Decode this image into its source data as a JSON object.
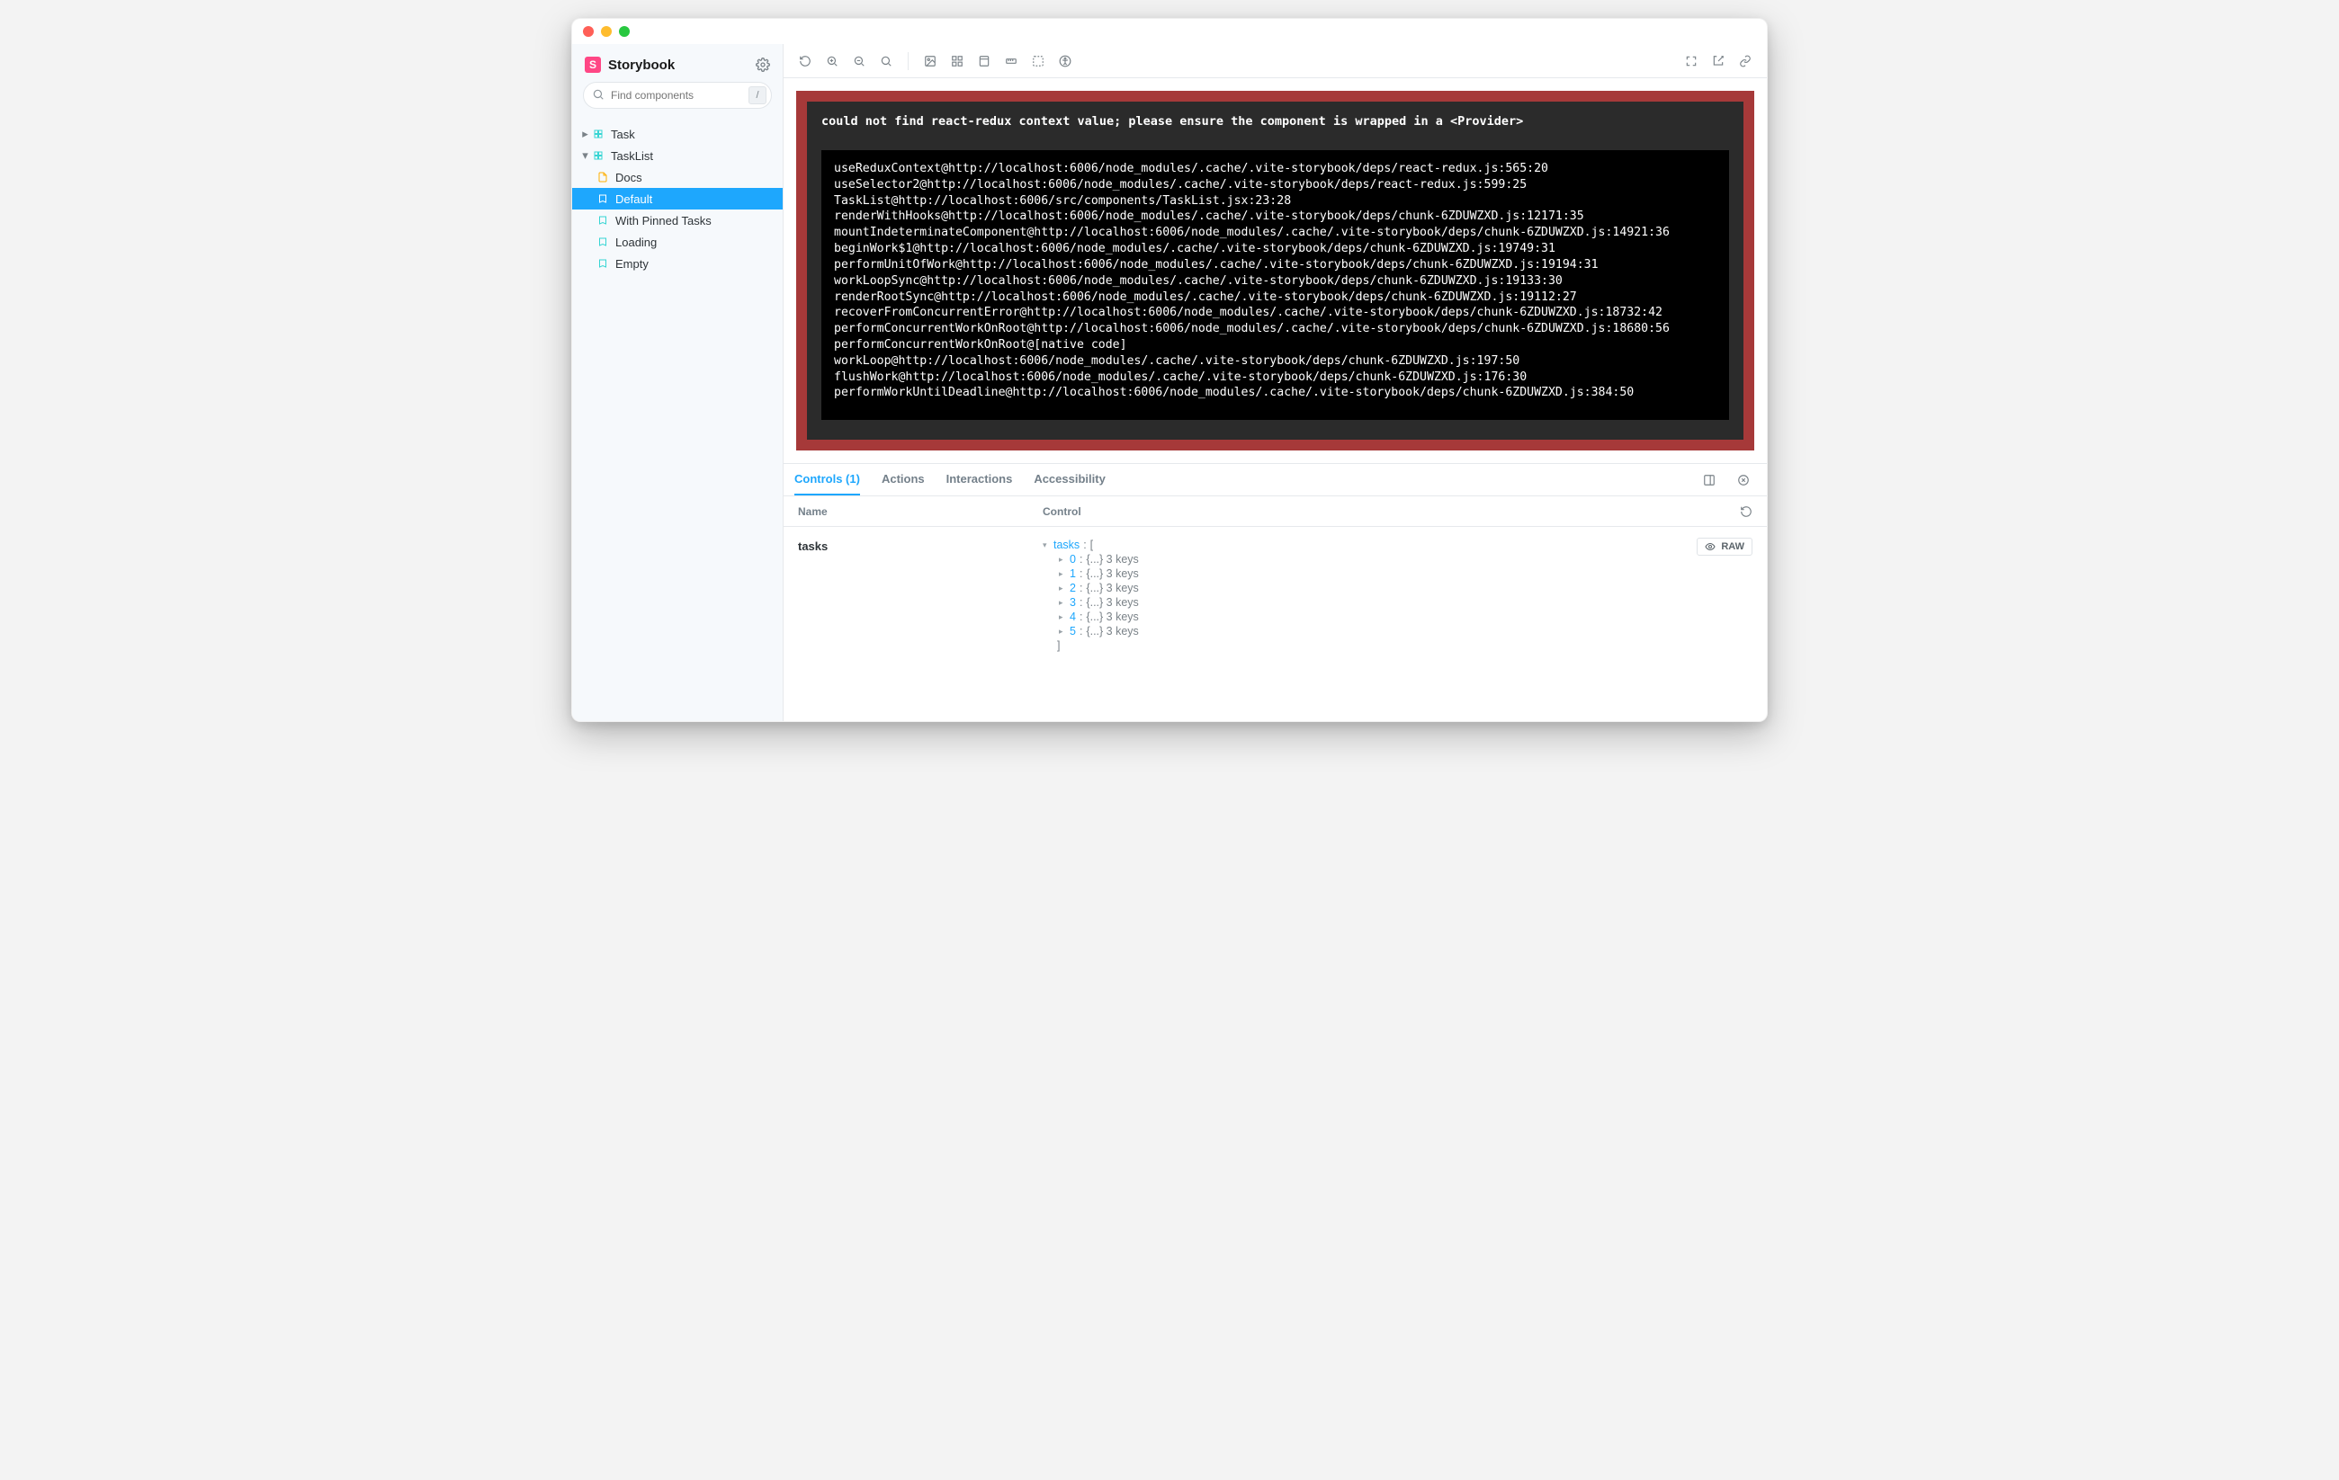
{
  "app": {
    "name": "Storybook"
  },
  "search": {
    "placeholder": "Find components",
    "shortcut": "/"
  },
  "tree": {
    "items": [
      {
        "label": "Task",
        "kind": "component",
        "level": 0,
        "expanded": false
      },
      {
        "label": "TaskList",
        "kind": "component",
        "level": 0,
        "expanded": true
      },
      {
        "label": "Docs",
        "kind": "docs",
        "level": 1
      },
      {
        "label": "Default",
        "kind": "story",
        "level": 1,
        "selected": true
      },
      {
        "label": "With Pinned Tasks",
        "kind": "story",
        "level": 1
      },
      {
        "label": "Loading",
        "kind": "story",
        "level": 1
      },
      {
        "label": "Empty",
        "kind": "story",
        "level": 1
      }
    ]
  },
  "error": {
    "message": "could not find react-redux context value; please ensure the component is wrapped in a <Provider>",
    "stack": "useReduxContext@http://localhost:6006/node_modules/.cache/.vite-storybook/deps/react-redux.js:565:20\nuseSelector2@http://localhost:6006/node_modules/.cache/.vite-storybook/deps/react-redux.js:599:25\nTaskList@http://localhost:6006/src/components/TaskList.jsx:23:28\nrenderWithHooks@http://localhost:6006/node_modules/.cache/.vite-storybook/deps/chunk-6ZDUWZXD.js:12171:35\nmountIndeterminateComponent@http://localhost:6006/node_modules/.cache/.vite-storybook/deps/chunk-6ZDUWZXD.js:14921:36\nbeginWork$1@http://localhost:6006/node_modules/.cache/.vite-storybook/deps/chunk-6ZDUWZXD.js:19749:31\nperformUnitOfWork@http://localhost:6006/node_modules/.cache/.vite-storybook/deps/chunk-6ZDUWZXD.js:19194:31\nworkLoopSync@http://localhost:6006/node_modules/.cache/.vite-storybook/deps/chunk-6ZDUWZXD.js:19133:30\nrenderRootSync@http://localhost:6006/node_modules/.cache/.vite-storybook/deps/chunk-6ZDUWZXD.js:19112:27\nrecoverFromConcurrentError@http://localhost:6006/node_modules/.cache/.vite-storybook/deps/chunk-6ZDUWZXD.js:18732:42\nperformConcurrentWorkOnRoot@http://localhost:6006/node_modules/.cache/.vite-storybook/deps/chunk-6ZDUWZXD.js:18680:56\nperformConcurrentWorkOnRoot@[native code]\nworkLoop@http://localhost:6006/node_modules/.cache/.vite-storybook/deps/chunk-6ZDUWZXD.js:197:50\nflushWork@http://localhost:6006/node_modules/.cache/.vite-storybook/deps/chunk-6ZDUWZXD.js:176:30\nperformWorkUntilDeadline@http://localhost:6006/node_modules/.cache/.vite-storybook/deps/chunk-6ZDUWZXD.js:384:50"
  },
  "addons": {
    "tabs": [
      {
        "label": "Controls (1)",
        "active": true
      },
      {
        "label": "Actions"
      },
      {
        "label": "Interactions"
      },
      {
        "label": "Accessibility"
      }
    ],
    "columns": {
      "name": "Name",
      "control": "Control"
    },
    "controls": {
      "name": "tasks",
      "root_key": "tasks",
      "root_open": "[",
      "root_close": "]",
      "raw_label": "RAW",
      "items": [
        {
          "key": "0",
          "summary": "{...} 3 keys"
        },
        {
          "key": "1",
          "summary": "{...} 3 keys"
        },
        {
          "key": "2",
          "summary": "{...} 3 keys"
        },
        {
          "key": "3",
          "summary": "{...} 3 keys"
        },
        {
          "key": "4",
          "summary": "{...} 3 keys"
        },
        {
          "key": "5",
          "summary": "{...} 3 keys"
        }
      ]
    }
  }
}
